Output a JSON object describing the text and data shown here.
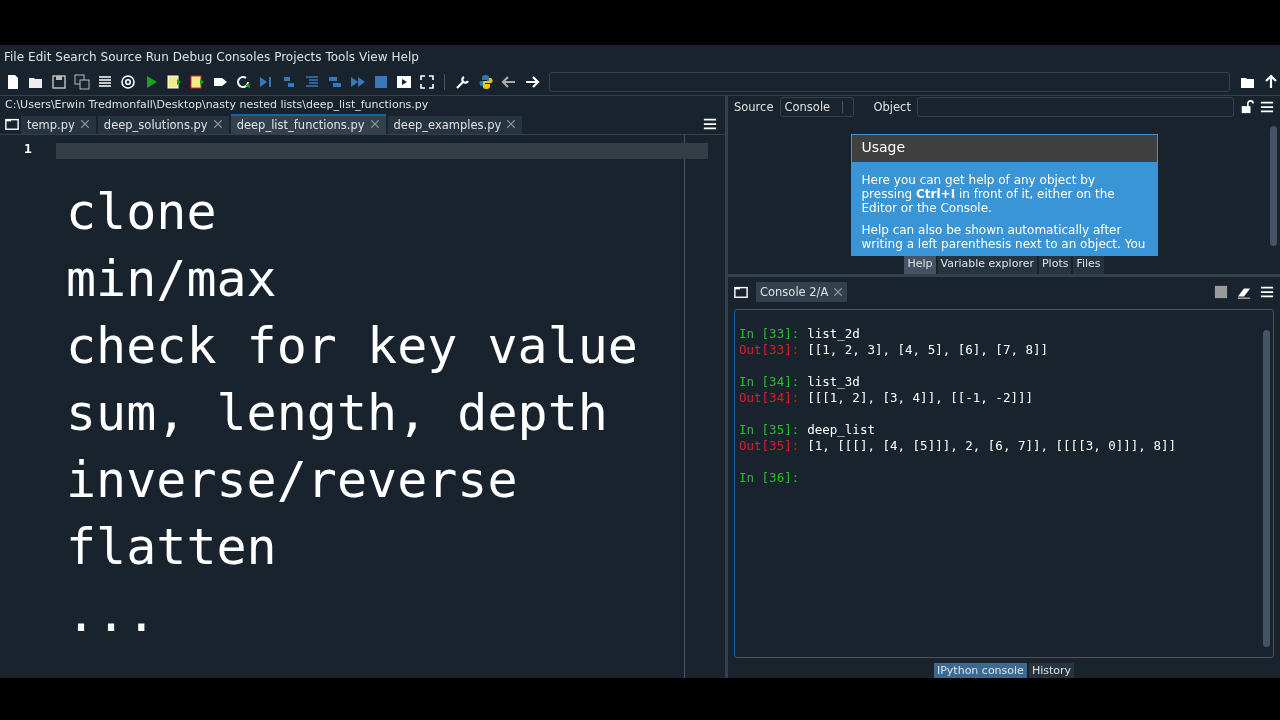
{
  "menu_bar": [
    "File",
    "Edit",
    "Search",
    "Source",
    "Run",
    "Debug",
    "Consoles",
    "Projects",
    "Tools",
    "View",
    "Help"
  ],
  "file_path": "C:\\Users\\Erwin Tredmonfall\\Desktop\\nasty nested lists\\deep_list_functions.py",
  "editor_tabs": [
    {
      "label": "temp.py",
      "selected": false
    },
    {
      "label": "deep_solutions.py",
      "selected": false
    },
    {
      "label": "deep_list_functions.py",
      "selected": true
    },
    {
      "label": "deep_examples.py",
      "selected": false
    }
  ],
  "editor": {
    "line_numbers": [
      "1"
    ],
    "overlay_lines": [
      "clone",
      "min/max",
      "check for key value",
      "sum, length, depth",
      "inverse/reverse",
      "flatten",
      "..."
    ]
  },
  "help_pane": {
    "source_label": "Source",
    "source_value": "Console",
    "object_label": "Object",
    "usage_title": "Usage",
    "usage_paragraphs": [
      "Here you can get help of any object by pressing **Ctrl+I** in front of it, either on the Editor or the Console.",
      "Help can also be shown automatically after writing a left parenthesis next to an object. You"
    ],
    "tabs": [
      {
        "label": "Help",
        "selected": true
      },
      {
        "label": "Variable explorer",
        "selected": false
      },
      {
        "label": "Plots",
        "selected": false
      },
      {
        "label": "Files",
        "selected": false
      }
    ]
  },
  "console": {
    "tabs": [
      {
        "label": "Console 2/A",
        "selected": true
      }
    ],
    "cells": [
      {
        "in_prompt": "In [33]:",
        "input": "list_2d",
        "out_prompt": "Out[33]:",
        "output": "[[1, 2, 3], [4, 5], [6], [7, 8]]"
      },
      {
        "in_prompt": "In [34]:",
        "input": "list_3d",
        "out_prompt": "Out[34]:",
        "output": "[[[1, 2], [3, 4]], [[-1, -2]]]"
      },
      {
        "in_prompt": "In [35]:",
        "input": "deep_list",
        "out_prompt": "Out[35]:",
        "output": "[1, [[[], [4, [5]]], 2, [6, 7]], [[[[3, 0]]], 8]]"
      },
      {
        "in_prompt": "In [36]:"
      }
    ],
    "bottom_tabs": [
      {
        "label": "IPython console",
        "selected": true
      },
      {
        "label": "History",
        "selected": false
      }
    ]
  }
}
